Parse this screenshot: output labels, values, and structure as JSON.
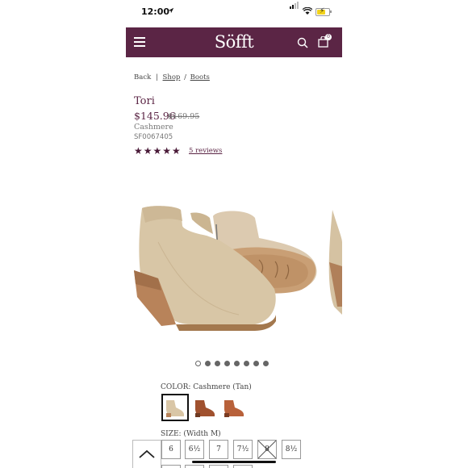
{
  "status_bar": {
    "time": "12:00"
  },
  "header": {
    "logo": "Söfft",
    "bag_count": "0"
  },
  "breadcrumb": {
    "back": "Back",
    "sep1": "|",
    "shop": "Shop",
    "sep2": "/",
    "boots": "Boots"
  },
  "product": {
    "name": "Tori",
    "price": "$145.96",
    "original_price": "$169.95",
    "color": "Cashmere",
    "sku": "SF0067405",
    "stars": "★★★★★",
    "reviews": "5 reviews"
  },
  "gallery": {
    "slide_count": 8,
    "active_slide": 0
  },
  "color_section": {
    "label": "COLOR: Cashmere (Tan)",
    "swatch_colors": [
      "#d9c6a6",
      "#a0512e",
      "#b8613a"
    ]
  },
  "size_section": {
    "label": "SIZE: (Width M)",
    "sizes": [
      "6",
      "6½",
      "7",
      "7½",
      "8",
      "8½"
    ]
  },
  "colors": {
    "brand": "#5b2545",
    "accent_text": "#5b2545"
  }
}
